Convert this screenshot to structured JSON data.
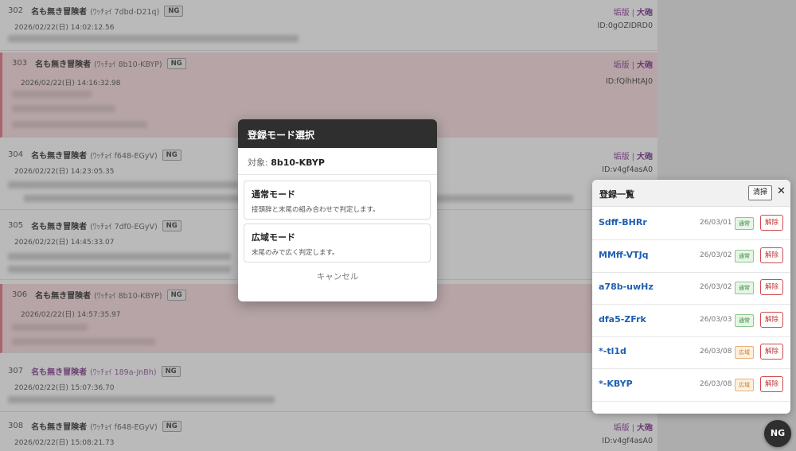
{
  "posts": [
    {
      "num": "302",
      "name": "名も無き冒険者",
      "trip": "(ﾜｯﾁｮｲ 7dbd-D21q)",
      "ng": "NG",
      "date": "2026/02/22(日) 14:02:12.56",
      "link_ng": "垢版",
      "link_sep": "|",
      "link_big": "大砲",
      "id": "ID:0gOZIDRD0"
    },
    {
      "num": "303",
      "name": "名も無き冒険者",
      "trip": "(ﾜｯﾁｮｲ 8b10-KBYP)",
      "ng": "NG",
      "date": "2026/02/22(日) 14:16:32.98",
      "link_ng": "垢版",
      "link_sep": "|",
      "link_big": "大砲",
      "id": "ID:fQlhHtAJ0"
    },
    {
      "num": "304",
      "name": "名も無き冒険者",
      "trip": "(ﾜｯﾁｮｲ f648-EGyV)",
      "ng": "NG",
      "date": "2026/02/22(日) 14:23:05.35",
      "link_ng": "垢版",
      "link_sep": "|",
      "link_big": "大砲",
      "id": "ID:v4gf4asA0"
    },
    {
      "num": "305",
      "name": "名も無き冒険者",
      "trip": "(ﾜｯﾁｮｲ 7df0-EGyV)",
      "ng": "NG",
      "date": "2026/02/22(日) 14:45:33.07",
      "link_ng": "",
      "link_sep": "",
      "link_big": "",
      "id": ""
    },
    {
      "num": "306",
      "name": "名も無き冒険者",
      "trip": "(ﾜｯﾁｮｲ 8b10-KBYP)",
      "ng": "NG",
      "date": "2026/02/22(日) 14:57:35.97",
      "link_ng": "",
      "link_sep": "",
      "link_big": "",
      "id": ""
    },
    {
      "num": "307",
      "name": "名も無き冒険者",
      "trip": "(ﾜｯﾁｮｲ 189a-JnBh)",
      "ng": "NG",
      "date": "2026/02/22(日) 15:07:36.70",
      "link_ng": "",
      "link_sep": "",
      "link_big": "",
      "id": ""
    },
    {
      "num": "308",
      "name": "名も無き冒険者",
      "trip": "(ﾜｯﾁｮｲ f648-EGyV)",
      "ng": "NG",
      "date": "2026/02/22(日) 15:08:21.73",
      "link_ng": "垢版",
      "link_sep": "|",
      "link_big": "大砲",
      "id": "ID:v4gf4asA0"
    }
  ],
  "modal": {
    "title": "登録モード選択",
    "target_label": "対象:",
    "target_value": "8b10-KBYP",
    "normal_title": "通常モード",
    "normal_desc": "接頭辞と末尾の組み合わせで判定します。",
    "wide_title": "広域モード",
    "wide_desc": "末尾のみで広く判定します。",
    "cancel": "キャンセル"
  },
  "panel": {
    "title": "登録一覧",
    "clear": "清掃",
    "close": "✕",
    "remove_label": "解除",
    "entries": [
      {
        "code": "Sdff-BHRr",
        "date": "26/03/01",
        "mode": "通常"
      },
      {
        "code": "MMff-VTJq",
        "date": "26/03/02",
        "mode": "通常"
      },
      {
        "code": "a78b-uwHz",
        "date": "26/03/02",
        "mode": "通常"
      },
      {
        "code": "dfa5-ZFrk",
        "date": "26/03/03",
        "mode": "通常"
      },
      {
        "code": "*-tl1d",
        "date": "26/03/08",
        "mode": "広域"
      },
      {
        "code": "*-KBYP",
        "date": "26/03/08",
        "mode": "広域"
      }
    ]
  },
  "fab": {
    "label": "NG"
  },
  "colors": {
    "accent_name": "#7b2d8a",
    "link_blue": "#1e5fb3",
    "highlight_bg": "#f9dadd",
    "remove_red": "#c13a3a"
  }
}
